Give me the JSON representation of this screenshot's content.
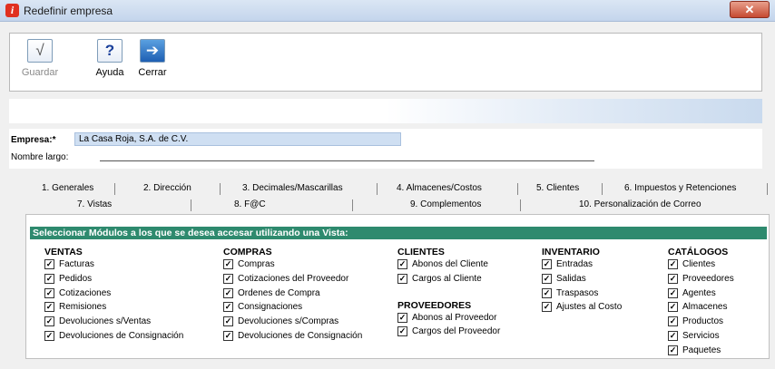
{
  "window": {
    "title": "Redefinir empresa",
    "close_glyph": "✕"
  },
  "toolbar": {
    "guardar": {
      "label": "Guardar",
      "icon": "check-icon",
      "glyph": "√"
    },
    "ayuda": {
      "label": "Ayuda",
      "icon": "help-icon",
      "glyph": "?"
    },
    "cerrar": {
      "label": "Cerrar",
      "icon": "exit-door-icon",
      "glyph": "➔"
    }
  },
  "form": {
    "empresa_label": "Empresa:*",
    "empresa_value": "La Casa Roja, S.A. de C.V.",
    "nombre_largo_label": "Nombre largo:"
  },
  "tabs_row1": [
    "1. Generales",
    "2. Dirección",
    "3. Decimales/Mascarillas",
    "4. Almacenes/Costos",
    "5. Clientes",
    "6. Impuestos y Retenciones"
  ],
  "tabs_row2": [
    "7. Vistas",
    "8. F@C",
    "9. Complementos",
    "10. Personalización de Correo"
  ],
  "panel": {
    "header": "Seleccionar Módulos a los que se desea accesar utilizando una Vista:",
    "check_glyph": "✓",
    "ventas": {
      "title": "VENTAS",
      "items": [
        "Facturas",
        "Pedidos",
        "Cotizaciones",
        "Remisiones",
        "Devoluciones s/Ventas",
        "Devoluciones de Consignación"
      ]
    },
    "compras": {
      "title": "COMPRAS",
      "items": [
        "Compras",
        "Cotizaciones del Proveedor",
        "Ordenes de Compra",
        "Consignaciones",
        "Devoluciones s/Compras",
        "Devoluciones de Consignación"
      ]
    },
    "clientes": {
      "title": "CLIENTES",
      "items": [
        "Abonos del Cliente",
        "Cargos al Cliente"
      ]
    },
    "proveedores": {
      "title": "PROVEEDORES",
      "items": [
        "Abonos al Proveedor",
        "Cargos del Proveedor"
      ]
    },
    "inventario": {
      "title": "INVENTARIO",
      "items": [
        "Entradas",
        "Salidas",
        "Traspasos",
        "Ajustes al Costo"
      ]
    },
    "catalogos": {
      "title": "CATÁLOGOS",
      "items": [
        "Clientes",
        "Proveedores",
        "Agentes",
        "Almacenes",
        "Productos",
        "Servicios",
        "Paquetes"
      ]
    }
  }
}
